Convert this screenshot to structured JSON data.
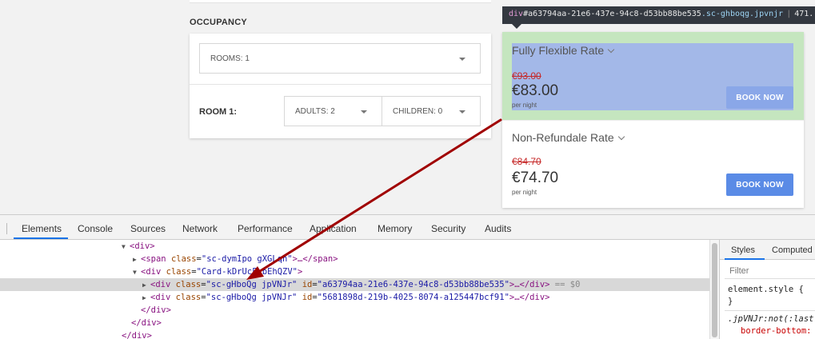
{
  "occupancy": {
    "title": "OCCUPANCY",
    "rooms_select": "ROOMS: 1",
    "room_label": "ROOM 1:",
    "adults_select": "ADULTS: 2",
    "children_select": "CHILDREN: 0"
  },
  "rates": [
    {
      "name": "Fully Flexible Rate",
      "old_price": "€93.00",
      "price": "€83.00",
      "per_night": "per night",
      "button": "BOOK NOW"
    },
    {
      "name": "Non-Refundale Rate",
      "old_price": "€84.70",
      "price": "€74.70",
      "per_night": "per night",
      "button": "BOOK NOW"
    }
  ],
  "tooltip": {
    "tag": "div",
    "id": "#a63794aa-21e6-437e-94c8-d53bb88be535",
    "classes": ".sc-ghboqg.jpvnjr",
    "size": "471."
  },
  "devtools": {
    "tabs": [
      "Elements",
      "Console",
      "Sources",
      "Network",
      "Performance",
      "Application",
      "Memory",
      "Security",
      "Audits"
    ],
    "active_tab": "Elements",
    "dom": {
      "div_open": "<div>",
      "span_tag": "<span",
      "span_class_attr": "class",
      "span_class_val": "\"sc-dymIpo gXGLqh\"",
      "span_rest": ">…</span>",
      "card_tag": "<div",
      "card_class_attr": "class",
      "card_class_val": "\"Card-kDrUcF bEhQZV\"",
      "card_close": ">",
      "row1_tag": "<div",
      "row1_class_attr": "class",
      "row1_class_val": "\"sc-gHboQg jpVNJr\"",
      "row1_id_attr": "id",
      "row1_id_val": "\"a63794aa-21e6-437e-94c8-d53bb88be535\"",
      "row1_rest": ">…</div>",
      "row1_eq": "== $0",
      "row2_tag": "<div",
      "row2_class_attr": "class",
      "row2_class_val": "\"sc-gHboQg jpVNJr\"",
      "row2_id_attr": "id",
      "row2_id_val": "\"5681898d-219b-4025-8074-a125447bcf91\"",
      "row2_rest": ">…</div>",
      "close1": "</div>",
      "close2": "</div>",
      "close3": "</div>"
    },
    "styles_panel": {
      "tabs": [
        "Styles",
        "Computed"
      ],
      "filter_placeholder": "Filter",
      "element_style": "element.style {",
      "element_style_close": "}",
      "rule_selector": ".jpVNJr:not(:last",
      "rule_prop": "border-bottom:"
    }
  },
  "colors": {
    "highlight_margin": "#c5e6bf",
    "highlight_content": "#a3b8e8",
    "book_button": "#5a8be6",
    "old_price": "#c62828",
    "annotation_arrow": "#a00000"
  }
}
